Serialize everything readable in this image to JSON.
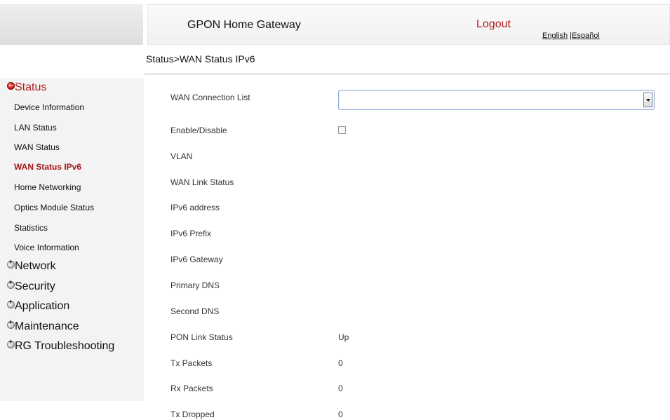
{
  "header": {
    "title": "GPON Home Gateway",
    "logout": "Logout",
    "lang_english": "English",
    "lang_separator": " |",
    "lang_spanish": "Español"
  },
  "breadcrumb": "Status>WAN Status IPv6",
  "sidebar": {
    "status_group": "Status",
    "status_items": [
      {
        "label": "Device Information"
      },
      {
        "label": "LAN Status"
      },
      {
        "label": "WAN Status"
      },
      {
        "label": "WAN Status IPv6",
        "active": true
      },
      {
        "label": "Home Networking"
      },
      {
        "label": "Optics Module Status"
      },
      {
        "label": "Statistics"
      },
      {
        "label": "Voice Information"
      }
    ],
    "groups": [
      {
        "label": "Network"
      },
      {
        "label": "Security"
      },
      {
        "label": "Application"
      },
      {
        "label": "Maintenance"
      },
      {
        "label": "RG Troubleshooting"
      }
    ]
  },
  "form": {
    "wan_connection_list": {
      "label": "WAN Connection List",
      "value": ""
    },
    "enable_disable": {
      "label": "Enable/Disable",
      "checked": false
    },
    "rows": [
      {
        "label": "VLAN",
        "value": ""
      },
      {
        "label": "WAN Link Status",
        "value": ""
      },
      {
        "label": "IPv6 address",
        "value": ""
      },
      {
        "label": "IPv6 Prefix",
        "value": ""
      },
      {
        "label": "IPv6 Gateway",
        "value": ""
      },
      {
        "label": "Primary DNS",
        "value": ""
      },
      {
        "label": "Second DNS",
        "value": ""
      },
      {
        "label": "PON Link Status",
        "value": "Up"
      },
      {
        "label": "Tx Packets",
        "value": "0"
      },
      {
        "label": "Rx Packets",
        "value": "0"
      },
      {
        "label": "Tx Dropped",
        "value": "0"
      }
    ]
  },
  "colors": {
    "accent_red": "#b01c1c",
    "sidebar_bg": "#f3f3f3"
  }
}
